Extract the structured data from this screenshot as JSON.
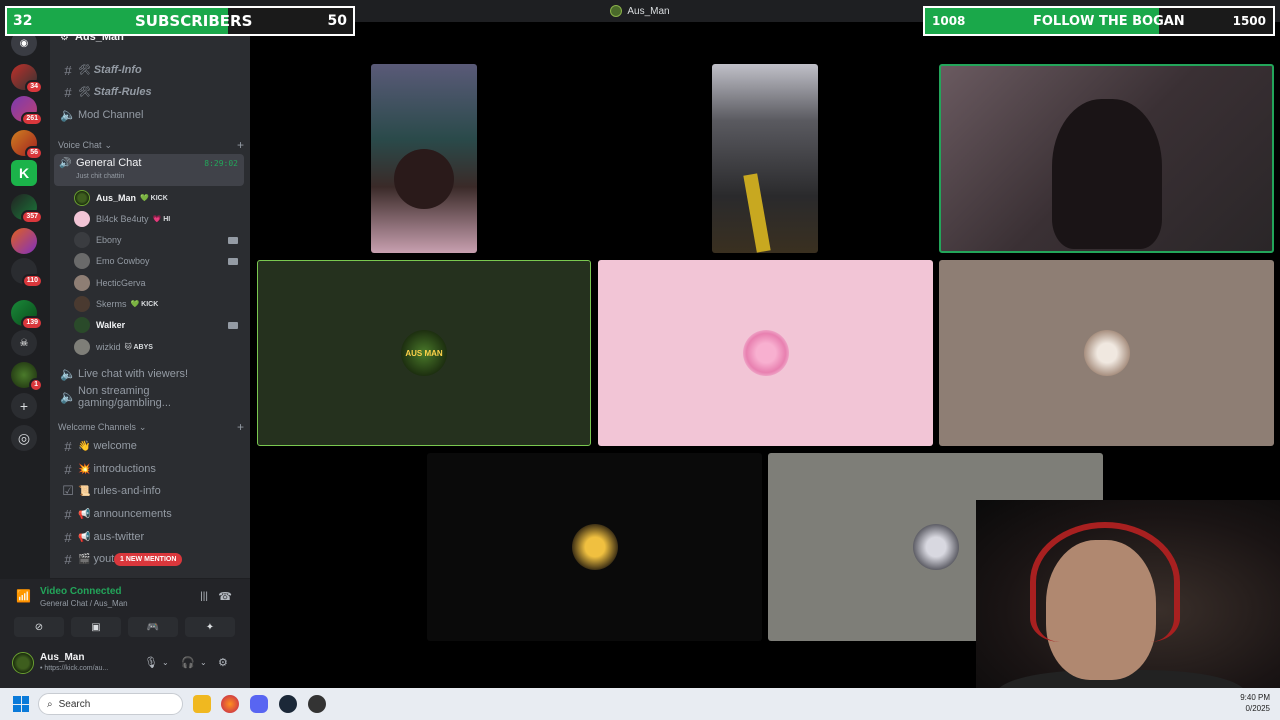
{
  "window": {
    "title": "Aus_Man"
  },
  "overlays": {
    "subscribers": {
      "current": "32",
      "label": "SUBSCRIBERS",
      "goal": "50",
      "progress": 0.64,
      "fill_color": "#1aa84a"
    },
    "follow": {
      "current": "1008",
      "label": "FOLLOW THE BOGAN",
      "goal": "1500",
      "progress": 0.672,
      "fill_color": "#1aa84a"
    }
  },
  "rail": {
    "servers": [
      {
        "badge": "34"
      },
      {
        "badge": "261"
      },
      {
        "badge": "56"
      },
      {
        "badge": ""
      },
      {
        "badge": "357"
      },
      {
        "badge": ""
      },
      {
        "badge": "110"
      },
      {
        "badge": "139"
      },
      {
        "badge": ""
      },
      {
        "badge": "1"
      }
    ]
  },
  "sidebar": {
    "server_name": "Aus_Man",
    "channels_top": [
      {
        "icon": "hash",
        "emoji": "🛠",
        "label": "Staff-Info",
        "italic": true
      },
      {
        "icon": "hash",
        "emoji": "🛠",
        "label": "Staff-Rules",
        "italic": true
      },
      {
        "icon": "speaker",
        "emoji": "",
        "label": "Mod Channel",
        "italic": false
      }
    ],
    "voice_category": "Voice Chat",
    "active_voice": {
      "name": "General Chat",
      "status": "Just chit chattin",
      "timer": "8:29:02"
    },
    "voice_users": [
      {
        "name": "Aus_Man",
        "tag": "💚 KICK",
        "bright": true,
        "cam": false
      },
      {
        "name": "Bl4ck Be4uty",
        "tag": "💗 HI",
        "bright": false,
        "cam": false
      },
      {
        "name": "Ebony",
        "tag": "",
        "bright": false,
        "cam": true
      },
      {
        "name": "Emo Cowboy",
        "tag": "",
        "bright": false,
        "cam": true
      },
      {
        "name": "HecticGerva",
        "tag": "",
        "bright": false,
        "cam": false
      },
      {
        "name": "Skerms",
        "tag": "💚 KICK",
        "bright": false,
        "cam": false
      },
      {
        "name": "Walker",
        "tag": "",
        "bright": true,
        "cam": true
      },
      {
        "name": "wizkid",
        "tag": "🐱 ABYS",
        "bright": false,
        "cam": false
      }
    ],
    "voice_extra": [
      {
        "label": "Live chat with viewers!"
      },
      {
        "label": "Non streaming gaming/gambling..."
      }
    ],
    "welcome_category": "Welcome Channels",
    "welcome_channels": [
      {
        "emoji": "👋",
        "label": "welcome"
      },
      {
        "emoji": "💥",
        "label": "introductions"
      },
      {
        "emoji": "📜",
        "label": "rules-and-info"
      },
      {
        "emoji": "📢",
        "label": "announcements"
      },
      {
        "emoji": "📢",
        "label": "aus-twitter"
      },
      {
        "emoji": "🎬",
        "label": "yout"
      }
    ],
    "mention_pill": "1 NEW MENTION"
  },
  "voice_panel": {
    "title": "Video Connected",
    "sub": "General Chat / Aus_Man"
  },
  "user_panel": {
    "name": "Aus_Man",
    "status": "• https://kick.com/au..."
  },
  "tiles": {
    "aus_man_label": "AUS MAN"
  },
  "taskbar": {
    "search_placeholder": "Search",
    "time": "9:40 PM",
    "date": "0/2025"
  },
  "colors": {
    "discord_bg": "#2b2d31",
    "rail_bg": "#1e1f22",
    "accent_green": "#23a55a",
    "mention_red": "#da373c",
    "tile_pink": "#f2c5d6",
    "tile_taupe": "#8e7e74",
    "tile_grey": "#7e7e78",
    "tile_green": "#25311e"
  }
}
